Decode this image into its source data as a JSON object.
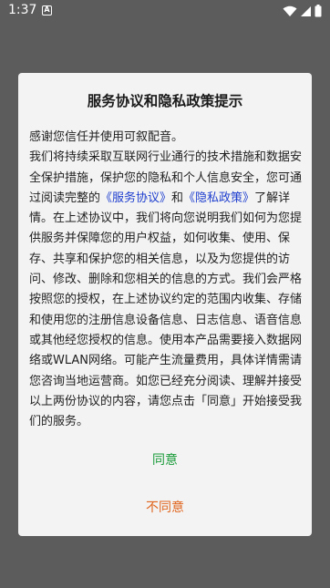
{
  "status_bar": {
    "time": "1:37",
    "notification_icon_letter": "A",
    "icons": [
      "wifi-icon",
      "signal-icon",
      "battery-icon"
    ]
  },
  "dialog": {
    "title": "服务协议和隐私政策提示",
    "intro": "感谢您信任并使用可叙配音。",
    "body_part1": "我们将持续采取互联网行业通行的技术措施和数据安全保护措施，保护您的隐私和个人信息安全，您可通过阅读完整的",
    "service_link": "《服务协议》",
    "and_text": "和",
    "privacy_link": "《隐私政策》",
    "body_part2": "了解详情。在上述协议中，我们将向您说明我们如何为您提供服务并保障您的用户权益，如何收集、使用、保存、共享和保护您的相关信息，以及为您提供的访问、修改、删除和您相关的信息的方式。我们会严格按照您的授权，在上述协议约定的范围内收集、存储和使用您的注册信息设备信息、日志信息、语音信息或其他经您授权的信息。使用本产品需要接入数据网络或WLAN网络。可能产生流量费用，具体详情需请您咨询当地运营商。如您已经充分阅读、理解并接受以上两份协议的内容，请您点击「同意」开始接受我们的服务。",
    "agree_label": "同意",
    "disagree_label": "不同意"
  },
  "colors": {
    "link": "#1f3fcf",
    "agree": "#1a9b3a",
    "disagree": "#e0661f"
  }
}
